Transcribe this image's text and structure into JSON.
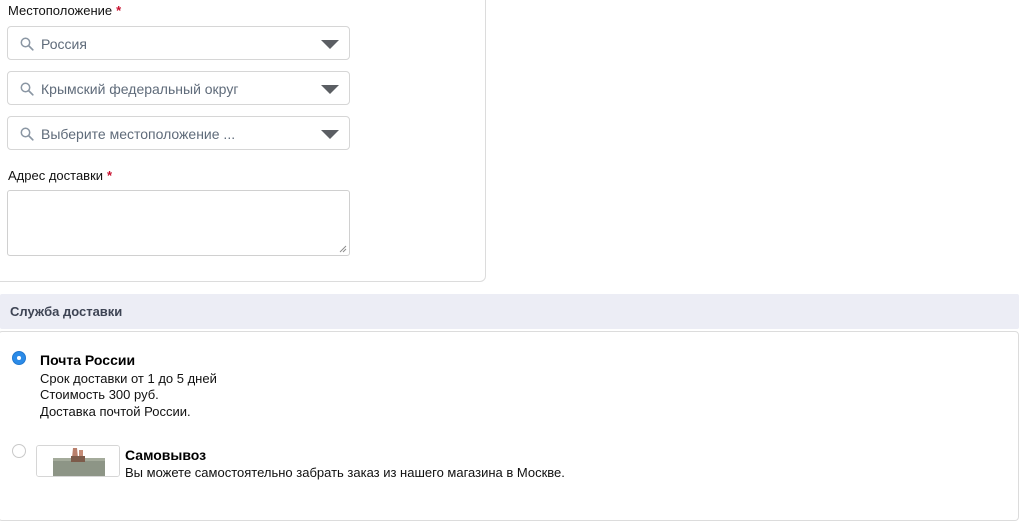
{
  "location": {
    "label": "Местоположение",
    "required_mark": "*",
    "selects": [
      {
        "value": "Россия",
        "icon": "search-icon"
      },
      {
        "value": "Крымский федеральный округ",
        "icon": "search-icon"
      },
      {
        "value": "Выберите местоположение ...",
        "icon": "search-icon"
      }
    ]
  },
  "address": {
    "label": "Адрес доставки",
    "required_mark": "*",
    "value": ""
  },
  "delivery": {
    "section_title": "Служба доставки",
    "options": [
      {
        "title": "Почта России",
        "selected": true,
        "lines": [
          "Срок доставки от 1 до 5 дней",
          "Стоимость 300 руб.",
          "Доставка почтой России."
        ]
      },
      {
        "title": "Самовывоз",
        "selected": false,
        "lines": [
          "Вы можете самостоятельно забрать заказ из нашего магазина в Москве."
        ]
      }
    ]
  },
  "colors": {
    "required": "#c8102e",
    "radio_selected": "#2b8be8",
    "section_header_bg": "#ecedf5"
  }
}
